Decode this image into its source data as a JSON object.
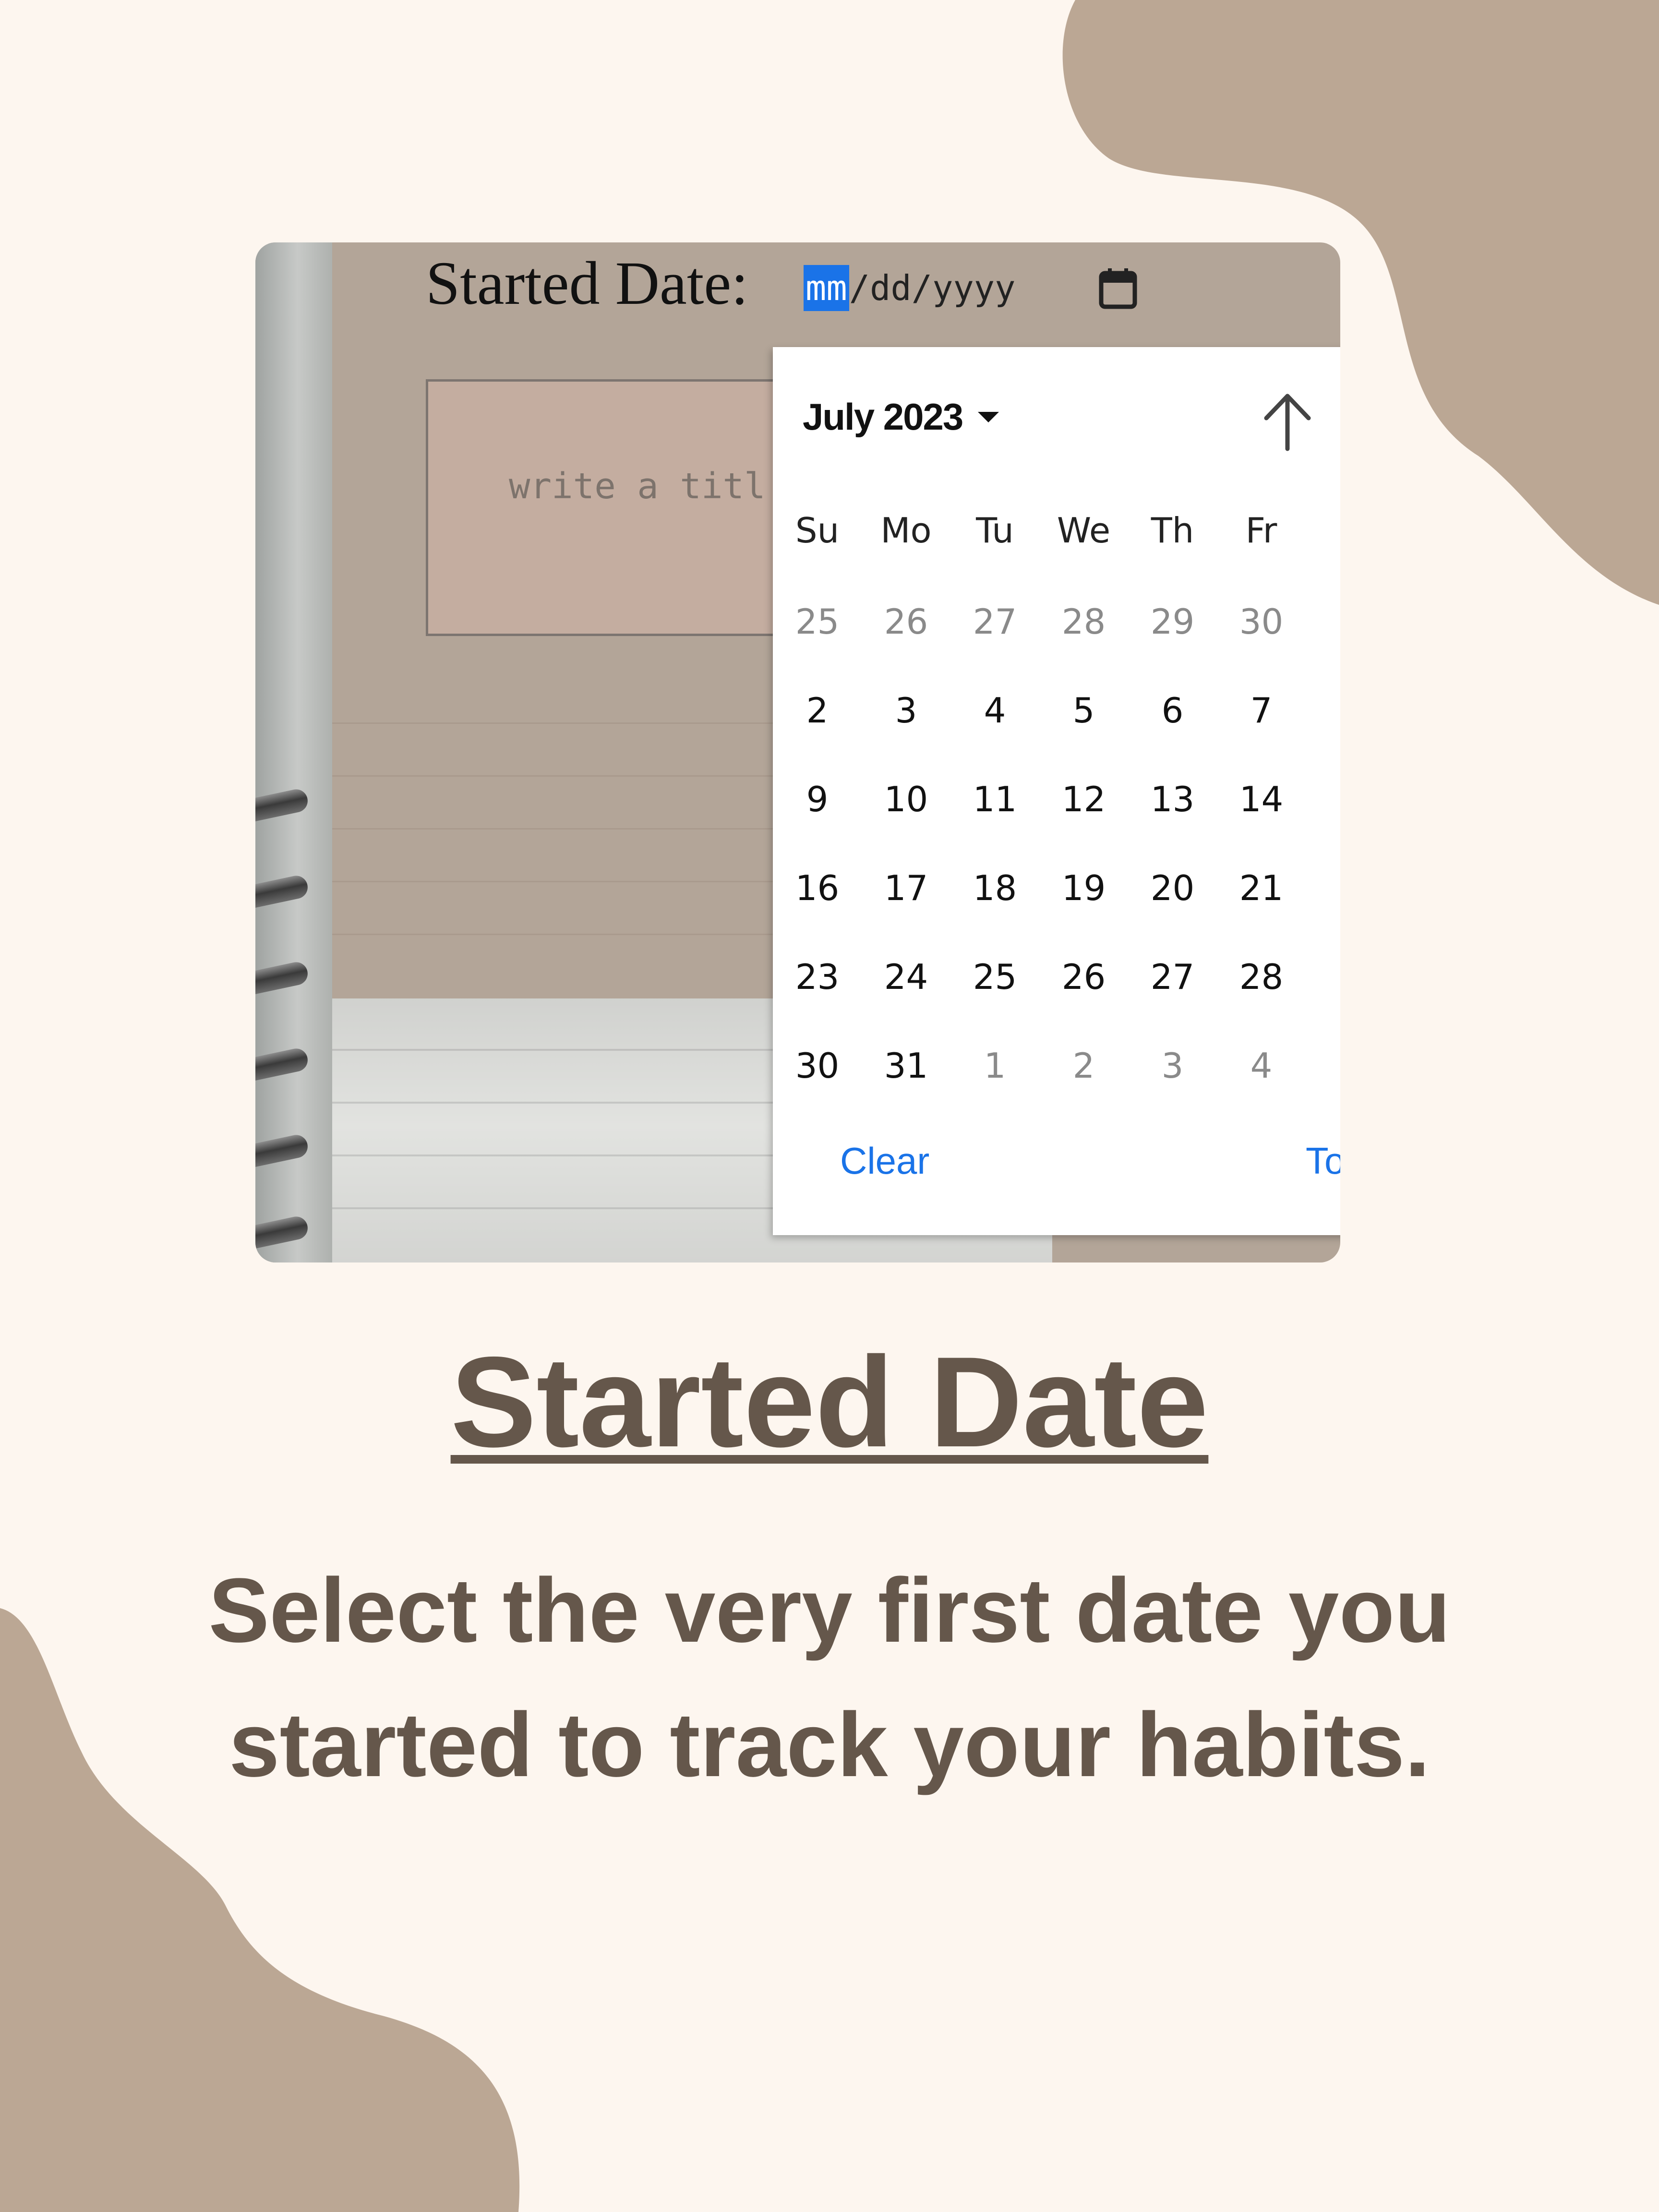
{
  "colors": {
    "background": "#fdf6ef",
    "blob": "#bba794",
    "heading_text": "#65574b",
    "accent_blue": "#1a73e8",
    "notebook_page": "#b3a598",
    "title_box": "#c4ada0"
  },
  "screenshot": {
    "field_label": "Started Date:",
    "date_input": {
      "month_segment": "mm",
      "rest": "/dd/yyyy",
      "icon": "calendar-icon"
    },
    "title_placeholder": "write a titl",
    "picker": {
      "month_year": "July 2023",
      "up_icon": "arrow-up-icon",
      "weekdays": [
        "Su",
        "Mo",
        "Tu",
        "We",
        "Th",
        "Fr"
      ],
      "weeks": [
        [
          {
            "d": "25",
            "muted": true
          },
          {
            "d": "26",
            "muted": true
          },
          {
            "d": "27",
            "muted": true
          },
          {
            "d": "28",
            "muted": true
          },
          {
            "d": "29",
            "muted": true
          },
          {
            "d": "30",
            "muted": true
          }
        ],
        [
          {
            "d": "2"
          },
          {
            "d": "3"
          },
          {
            "d": "4"
          },
          {
            "d": "5"
          },
          {
            "d": "6"
          },
          {
            "d": "7"
          }
        ],
        [
          {
            "d": "9"
          },
          {
            "d": "10"
          },
          {
            "d": "11"
          },
          {
            "d": "12"
          },
          {
            "d": "13"
          },
          {
            "d": "14"
          }
        ],
        [
          {
            "d": "16"
          },
          {
            "d": "17"
          },
          {
            "d": "18"
          },
          {
            "d": "19"
          },
          {
            "d": "20"
          },
          {
            "d": "21"
          }
        ],
        [
          {
            "d": "23"
          },
          {
            "d": "24"
          },
          {
            "d": "25"
          },
          {
            "d": "26"
          },
          {
            "d": "27"
          },
          {
            "d": "28"
          }
        ],
        [
          {
            "d": "30"
          },
          {
            "d": "31"
          },
          {
            "d": "1",
            "muted": true
          },
          {
            "d": "2",
            "muted": true
          },
          {
            "d": "3",
            "muted": true
          },
          {
            "d": "4",
            "muted": true
          }
        ]
      ],
      "clear_label": "Clear",
      "today_label": "Toc"
    }
  },
  "heading": "Started Date",
  "description": {
    "line1": "Select the very first date you",
    "line2": "started to track your habits."
  }
}
